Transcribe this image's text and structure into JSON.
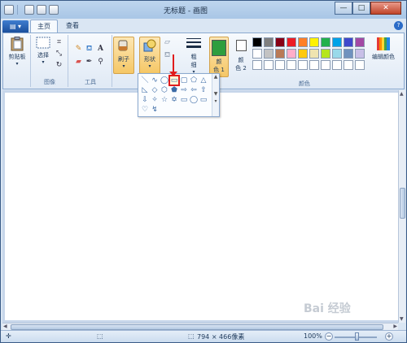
{
  "window": {
    "title": "无标题 - 画图",
    "controls": {
      "minimize": "—",
      "maximize": "□",
      "close": "✕"
    }
  },
  "tabs": {
    "app_menu": "▤ ▾",
    "items": [
      "主页",
      "查看"
    ],
    "active": "主页",
    "help": "?"
  },
  "ribbon": {
    "clipboard": {
      "label": "剪贴板",
      "button": "剪贴板"
    },
    "image": {
      "label": "图像",
      "select": "选择"
    },
    "tools": {
      "label": "工具"
    },
    "brushes": {
      "button": "刷子"
    },
    "shapes": {
      "button": "形状"
    },
    "size": {
      "button": "粗\n细"
    },
    "color1": {
      "label": "颜\n色 1",
      "color": "#2e9e3e"
    },
    "color2": {
      "label": "颜\n色 2",
      "color": "#ffffff"
    },
    "colors_group_label": "颜色",
    "edit_colors": "编辑颜色"
  },
  "shapes_panel": {
    "icons": [
      "＼",
      "∿",
      "◯",
      "▭",
      "▢",
      "⬠",
      "△",
      "◺",
      "◇",
      "⬡",
      "⬟",
      "⇨",
      "⇦",
      "⇧",
      "⇩",
      "✧",
      "☆",
      "✡",
      "▭",
      "◯",
      "▭",
      "♡",
      "↯",
      "",
      "",
      "",
      "",
      ""
    ],
    "selected_index": 3
  },
  "palette": {
    "colors": [
      "#000000",
      "#7f7f7f",
      "#880015",
      "#ed1c24",
      "#ff7f27",
      "#fff200",
      "#22b14c",
      "#00a2e8",
      "#3f48cc",
      "#a349a4",
      "#ffffff",
      "#c3c3c3",
      "#b97a57",
      "#ffaec9",
      "#ffc90e",
      "#efe4b0",
      "#b5e61d",
      "#99d9ea",
      "#7092be",
      "#c8bfe7",
      "#ffffff",
      "#ffffff",
      "#ffffff",
      "#ffffff",
      "#ffffff",
      "#ffffff",
      "#ffffff",
      "#ffffff",
      "#ffffff",
      "#ffffff"
    ]
  },
  "statusbar": {
    "cursor_icon": "✛",
    "selection_icon": "⬚",
    "canvas_size": "794 × 466像素",
    "zoom": "100%",
    "zoom_out": "−",
    "zoom_in": "+"
  },
  "watermark": "Bai 经验"
}
